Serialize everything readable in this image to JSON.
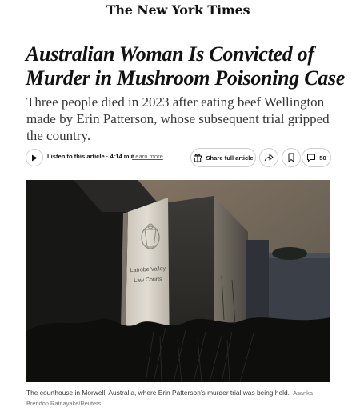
{
  "masthead": {
    "logo": "The New York Times"
  },
  "article": {
    "headline": "Australian Woman Is Convicted of Murder in Mushroom Poisoning Case",
    "dek": "Three people died in 2023 after eating beef Wellington made by Erin Patterson, whose subsequent trial gripped the country."
  },
  "toolbar": {
    "listen_label": "Listen to this article · 4:14 min",
    "learn_more": "Learn more",
    "share_full_label": "Share full article",
    "comment_count": "50"
  },
  "image": {
    "sign_text_line1": "Latrobe Valley",
    "sign_text_line2": "Law Courts",
    "caption": "The courthouse in Morwell, Australia, where Erin Patterson’s murder trial was being held.",
    "credit": "Asanka Brendon Ratnayake/Reuters"
  },
  "icons": {
    "play": "play-icon",
    "gift": "gift-icon",
    "share": "share-arrow-icon",
    "bookmark": "bookmark-icon",
    "comment": "comment-bubble-icon"
  }
}
